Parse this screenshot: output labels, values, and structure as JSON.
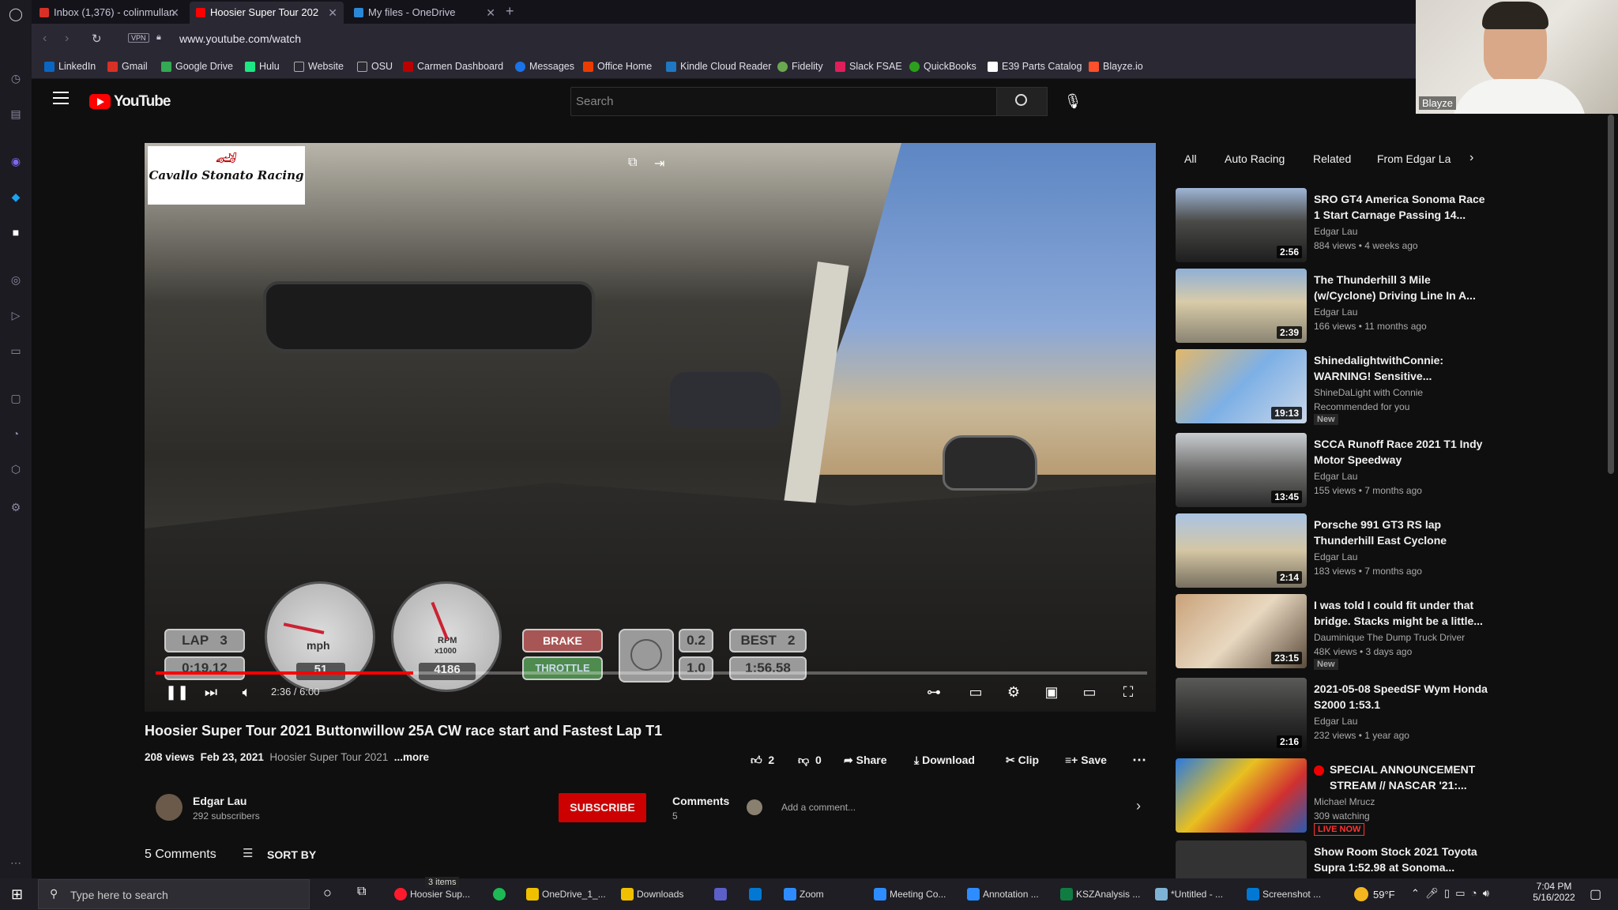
{
  "browser": {
    "tabs": [
      {
        "label": "Inbox (1,376) - colinmullan",
        "favicon_color": "#d93025"
      },
      {
        "label": "Hoosier Super Tour 202",
        "favicon_color": "#ff0000"
      },
      {
        "label": "My files - OneDrive",
        "favicon_color": "#2b88d8"
      }
    ],
    "vpn_label": "VPN",
    "url": "www.youtube.com/watch",
    "bookmarks": [
      {
        "label": "LinkedIn",
        "color": "#0a66c2"
      },
      {
        "label": "Gmail",
        "color": "#d93025"
      },
      {
        "label": "Google Drive",
        "color": "#34a853"
      },
      {
        "label": "Hulu",
        "color": "#1ce783"
      },
      {
        "label": "Website",
        "color": "#aaaaaa"
      },
      {
        "label": "OSU",
        "color": "#aaaaaa"
      },
      {
        "label": "Carmen Dashboard",
        "color": "#bb0000"
      },
      {
        "label": "Messages",
        "color": "#1a73e8"
      },
      {
        "label": "Office Home",
        "color": "#eb3c00"
      },
      {
        "label": "Kindle Cloud Reader",
        "color": "#1f78c1"
      },
      {
        "label": "Fidelity",
        "color": "#6aa84f"
      },
      {
        "label": "Slack FSAE",
        "color": "#e01e5a"
      },
      {
        "label": "QuickBooks",
        "color": "#2ca01c"
      },
      {
        "label": "E39 Parts Catalog",
        "color": "#ffffff"
      },
      {
        "label": "Blayze.io",
        "color": "#ff4f2b"
      }
    ]
  },
  "youtube": {
    "logo_text": "YouTube",
    "search_placeholder": "Search",
    "video": {
      "overlay_logo": "Cavallo Stonato Racing",
      "hud": {
        "lap_label": "LAP",
        "lap_value": "3",
        "lap_time": "0:19.12",
        "speed_unit": "mph",
        "speed_value": "51",
        "rpm_unit": "RPM",
        "rpm_multiplier": "x1000",
        "rpm_value": "4186",
        "brake_label": "BRAKE",
        "throttle_label": "THROTTLE",
        "g_lat": "0.2",
        "g_long": "1.0",
        "best_label": "BEST",
        "best_lap": "2",
        "best_time": "1:56.58"
      },
      "time_display": "2:36 / 6:00",
      "progress_fraction": 0.26
    },
    "title": "Hoosier Super Tour 2021 Buttonwillow 25A CW race start and Fastest Lap T1",
    "views": "208 views",
    "date": "Feb 23, 2021",
    "desc_snippet": "Hoosier Super Tour 2021",
    "more_label": "...more",
    "likes": "2",
    "dislikes": "0",
    "share_label": "Share",
    "download_label": "Download",
    "clip_label": "Clip",
    "save_label": "Save",
    "channel": {
      "name": "Edgar Lau",
      "subscribers": "292 subscribers"
    },
    "subscribe_label": "SUBSCRIBE",
    "comments_panel": {
      "label": "Comments",
      "count": "5",
      "placeholder": "Add a comment..."
    },
    "comments_header": "5 Comments",
    "sort_label": "SORT BY",
    "chips": [
      "All",
      "Auto Racing",
      "Related",
      "From Edgar La"
    ],
    "recommendations": [
      {
        "title": "SRO GT4 America Sonoma Race 1 Start Carnage Passing 14...",
        "channel": "Edgar Lau",
        "meta": "884 views • 4 weeks ago",
        "duration": "2:56",
        "badge": ""
      },
      {
        "title": "The Thunderhill 3 Mile (w/Cyclone) Driving Line In A...",
        "channel": "Edgar Lau",
        "meta": "166 views • 11 months ago",
        "duration": "2:39",
        "badge": ""
      },
      {
        "title": "ShinedalightwithConnie: WARNING! Sensitive...",
        "channel": "ShineDaLight with Connie",
        "meta": "Recommended for you",
        "duration": "19:13",
        "badge": "New"
      },
      {
        "title": "SCCA Runoff Race 2021 T1 Indy Motor Speedway",
        "channel": "Edgar Lau",
        "meta": "155 views • 7 months ago",
        "duration": "13:45",
        "badge": ""
      },
      {
        "title": "Porsche 991 GT3 RS lap Thunderhill East Cyclone",
        "channel": "Edgar Lau",
        "meta": "183 views • 7 months ago",
        "duration": "2:14",
        "badge": ""
      },
      {
        "title": "I was told I could fit under that bridge. Stacks might be a little...",
        "channel": "Dauminique The Dump Truck Driver",
        "meta": "48K views • 3 days ago",
        "duration": "23:15",
        "badge": "New"
      },
      {
        "title": "2021-05-08 SpeedSF Wym Honda S2000 1:53.1",
        "channel": "Edgar Lau",
        "meta": "232 views • 1 year ago",
        "duration": "2:16",
        "badge": ""
      },
      {
        "title": "SPECIAL ANNOUNCEMENT STREAM // NASCAR '21:...",
        "channel": "Michael Mrucz",
        "meta": "309 watching",
        "duration": "",
        "badge": "LIVE NOW"
      },
      {
        "title": "Show Room Stock 2021 Toyota Supra 1:52.98 at Sonoma...",
        "channel": "",
        "meta": "",
        "duration": "",
        "badge": ""
      }
    ]
  },
  "webcam": {
    "name": "Blayze"
  },
  "taskbar": {
    "search_placeholder": "Type here to search",
    "items_tooltip": "3 items",
    "apps": [
      {
        "label": "Hoosier Sup...",
        "color": "#ff1b2d"
      },
      {
        "label": "",
        "color": "#1db954"
      },
      {
        "label": "OneDrive_1_...",
        "color": "#f0c000"
      },
      {
        "label": "Downloads",
        "color": "#f0c000"
      },
      {
        "label": "",
        "color": "#5b5fc7"
      },
      {
        "label": "",
        "color": "#0078d4"
      },
      {
        "label": "Zoom",
        "color": "#2d8cff"
      },
      {
        "label": "Meeting Co...",
        "color": "#2d8cff"
      },
      {
        "label": "Annotation ...",
        "color": "#2d8cff"
      },
      {
        "label": "KSZAnalysis ...",
        "color": "#107c41"
      },
      {
        "label": "*Untitled - ...",
        "color": "#7fb3d5"
      },
      {
        "label": "Screenshot ...",
        "color": "#0078d4"
      }
    ],
    "weather": "59°F",
    "time": "7:04 PM",
    "date": "5/16/2022"
  }
}
